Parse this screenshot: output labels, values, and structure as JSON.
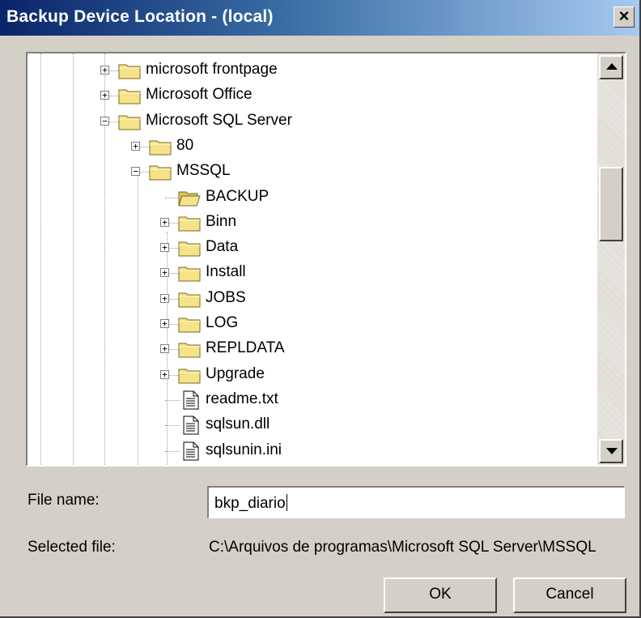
{
  "window": {
    "title": "Backup Device Location - (local)",
    "close_glyph": "×"
  },
  "tree": {
    "items": [
      {
        "label": "microsoft frontpage",
        "icon": "folder-icon",
        "expander": "+"
      },
      {
        "label": "Microsoft Office",
        "icon": "folder-icon",
        "expander": "+"
      },
      {
        "label": "Microsoft SQL Server",
        "icon": "folder-icon",
        "expander": "−"
      },
      {
        "label": "80",
        "icon": "folder-icon",
        "expander": "+"
      },
      {
        "label": "MSSQL",
        "icon": "folder-icon",
        "expander": "−"
      },
      {
        "label": "BACKUP",
        "icon": "open-folder-icon",
        "expander": ""
      },
      {
        "label": "Binn",
        "icon": "folder-icon",
        "expander": "+"
      },
      {
        "label": "Data",
        "icon": "folder-icon",
        "expander": "+"
      },
      {
        "label": "Install",
        "icon": "folder-icon",
        "expander": "+"
      },
      {
        "label": "JOBS",
        "icon": "folder-icon",
        "expander": "+"
      },
      {
        "label": "LOG",
        "icon": "folder-icon",
        "expander": "+"
      },
      {
        "label": "REPLDATA",
        "icon": "folder-icon",
        "expander": "+"
      },
      {
        "label": "Upgrade",
        "icon": "folder-icon",
        "expander": "+"
      },
      {
        "label": "readme.txt",
        "icon": "text-file-icon",
        "expander": ""
      },
      {
        "label": "sqlsun.dll",
        "icon": "text-file-icon",
        "expander": ""
      },
      {
        "label": "sqlsunin.ini",
        "icon": "text-file-icon",
        "expander": ""
      }
    ]
  },
  "form": {
    "file_name_label": "File name:",
    "file_name_value": "bkp_diario",
    "selected_file_label": "Selected file:",
    "selected_file_value": "C:\\Arquivos de programas\\Microsoft SQL Server\\MSSQL"
  },
  "buttons": {
    "ok": "OK",
    "cancel": "Cancel"
  },
  "colors": {
    "face": "#d4d0c8",
    "title_start": "#0a246a",
    "title_end": "#a6caf0",
    "folder": "#f5e38a"
  }
}
